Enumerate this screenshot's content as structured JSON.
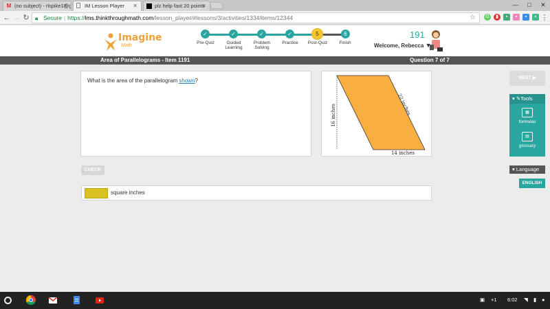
{
  "browser": {
    "tabs": [
      {
        "title": "(no subject) - rlspike1@g",
        "favicon": "gmail-icon",
        "active": false
      },
      {
        "title": "IM Lesson Player",
        "favicon": "page-icon",
        "active": true
      },
      {
        "title": "plz help fast 20 points",
        "favicon": "brainly-icon",
        "active": false
      }
    ],
    "address": {
      "secure_label": "Secure",
      "scheme": "https://",
      "domain": "lms.thinkthroughmath.com",
      "path": "/lesson_player/#lessons/3/activities/1334/items/12344"
    }
  },
  "app": {
    "logo_text": "Imagine",
    "logo_sub": "Math",
    "steps": [
      {
        "label": "Pre-Quiz",
        "mark": "✓"
      },
      {
        "label": "Guided\nLearning",
        "mark": "✓"
      },
      {
        "label": "Problem\nSolving",
        "mark": "✓"
      },
      {
        "label": "Practice",
        "mark": "✓"
      },
      {
        "label": "Post-Quiz",
        "mark": "5"
      },
      {
        "label": "Finish",
        "mark": "6"
      }
    ],
    "points": "191",
    "welcome": "Welcome, Rebecca",
    "welcome_caret": "▼"
  },
  "titlebar": {
    "lesson_title": "Area of Parallelograms - Item 1191",
    "question_counter": "Question 7 of 7"
  },
  "question": {
    "text_before": "What is the area of the parallelogram ",
    "link_text": "shown",
    "text_after": "?"
  },
  "figure": {
    "height_label": "16 inches",
    "side_label": "22 inches",
    "base_label": "14 inches",
    "fill_color": "#f9ae40"
  },
  "actions": {
    "check_label": "CHECK",
    "next_label": "NEXT ▶"
  },
  "answer": {
    "value": "",
    "unit": "square inches"
  },
  "tools": {
    "header": "Tools",
    "items": [
      {
        "label": "formulas",
        "icon": "calculator-icon"
      },
      {
        "label": "glossary",
        "icon": "book-icon"
      }
    ]
  },
  "language": {
    "header": "Language",
    "button": "ENGLISH"
  },
  "taskbar": {
    "notifications": "+1",
    "time": "6:02"
  }
}
